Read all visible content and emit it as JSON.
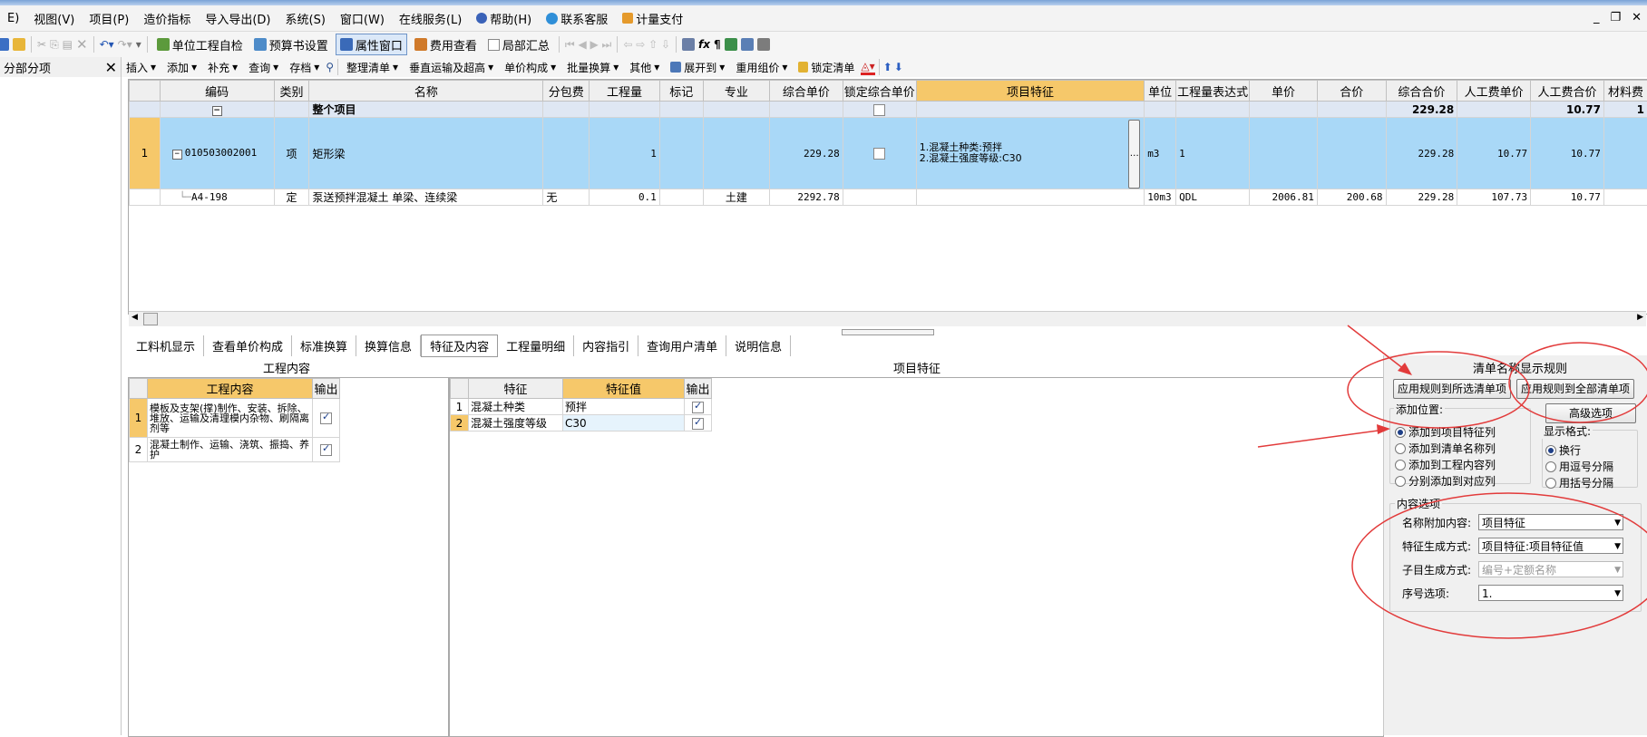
{
  "menu": {
    "items": [
      "E)",
      "视图(V)",
      "项目(P)",
      "造价指标",
      "导入导出(D)",
      "系统(S)",
      "窗口(W)",
      "在线服务(L)",
      "帮助(H)",
      "联系客服",
      "计量支付"
    ]
  },
  "toolbar1": {
    "unit_check": "单位工程自检",
    "budget_settings": "预算书设置",
    "property_window": "属性窗口",
    "fee_view": "费用查看",
    "partial_summary": "局部汇总"
  },
  "left_panel": {
    "title": "分部分项"
  },
  "toolbar2": {
    "items": [
      "插入",
      "添加",
      "补充",
      "查询",
      "存档",
      "整理清单",
      "垂直运输及超高",
      "单价构成",
      "批量换算",
      "其他",
      "展开到",
      "重用组价",
      "锁定清单"
    ]
  },
  "grid": {
    "headers": [
      "编码",
      "类别",
      "名称",
      "分包费",
      "工程量",
      "标记",
      "专业",
      "综合单价",
      "锁定综合单价",
      "项目特征",
      "单位",
      "工程量表达式",
      "单价",
      "合价",
      "综合合价",
      "人工费单价",
      "人工费合价",
      "材料费"
    ],
    "total_row": {
      "name": "整个项目",
      "comp_total": "229.28",
      "labor_total": "10.77",
      "material": "1"
    },
    "item_row": {
      "no": "1",
      "code": "010503002001",
      "type": "项",
      "name": "矩形梁",
      "qty": "1",
      "unit_price": "229.28",
      "feature_line1": "1.混凝土种类:预拌",
      "feature_line2": "2.混凝土强度等级:C30",
      "unit": "m3",
      "expr": "1",
      "comp_total": "229.28",
      "labor_unit": "10.77",
      "labor_total": "10.77"
    },
    "quota_row": {
      "code": "A4-198",
      "type": "定",
      "name": "泵送预拌混凝土 单梁、连续梁",
      "sub_fee": "无",
      "qty": "0.1",
      "major": "土建",
      "unit_price": "2292.78",
      "unit": "10m3",
      "expr": "QDL",
      "price": "2006.81",
      "total": "200.68",
      "comp_total": "229.28",
      "labor_unit": "107.73",
      "labor_total": "10.77"
    }
  },
  "tabs": [
    "工料机显示",
    "查看单价构成",
    "标准换算",
    "换算信息",
    "特征及内容",
    "工程量明细",
    "内容指引",
    "查询用户清单",
    "说明信息"
  ],
  "work_content": {
    "title": "工程内容",
    "headers": [
      "工程内容",
      "输出"
    ],
    "rows": [
      {
        "no": "1",
        "text": "模板及支架(撑)制作、安装、拆除、堆放、运输及清理模内杂物、刷隔离剂等"
      },
      {
        "no": "2",
        "text": "混凝土制作、运输、浇筑、振捣、养护"
      }
    ]
  },
  "features": {
    "title": "项目特征",
    "headers": [
      "特征",
      "特征值",
      "输出"
    ],
    "rows": [
      {
        "no": "1",
        "name": "混凝土种类",
        "value": "预拌"
      },
      {
        "no": "2",
        "name": "混凝土强度等级",
        "value": "C30"
      }
    ]
  },
  "rules": {
    "title": "清单名称显示规则",
    "apply_selected": "应用规则到所选清单项",
    "apply_all": "应用规则到全部清单项",
    "advanced": "高级选项",
    "position_title": "添加位置:",
    "positions": [
      "添加到项目特征列",
      "添加到清单名称列",
      "添加到工程内容列",
      "分别添加到对应列"
    ],
    "format_title": "显示格式:",
    "formats": [
      "换行",
      "用逗号分隔",
      "用括号分隔"
    ],
    "content_title": "内容选项",
    "name_append_label": "名称附加内容:",
    "name_append_value": "项目特征",
    "feature_gen_label": "特征生成方式:",
    "feature_gen_value": "项目特征:项目特征值",
    "child_gen_label": "子目生成方式:",
    "child_gen_value": "编号+定额名称",
    "seq_label": "序号选项:",
    "seq_value": "1."
  },
  "colors": {
    "accent_orange": "#f6c86a",
    "selected_row": "#a9d8f7",
    "annotation_red": "#e23b3b"
  }
}
